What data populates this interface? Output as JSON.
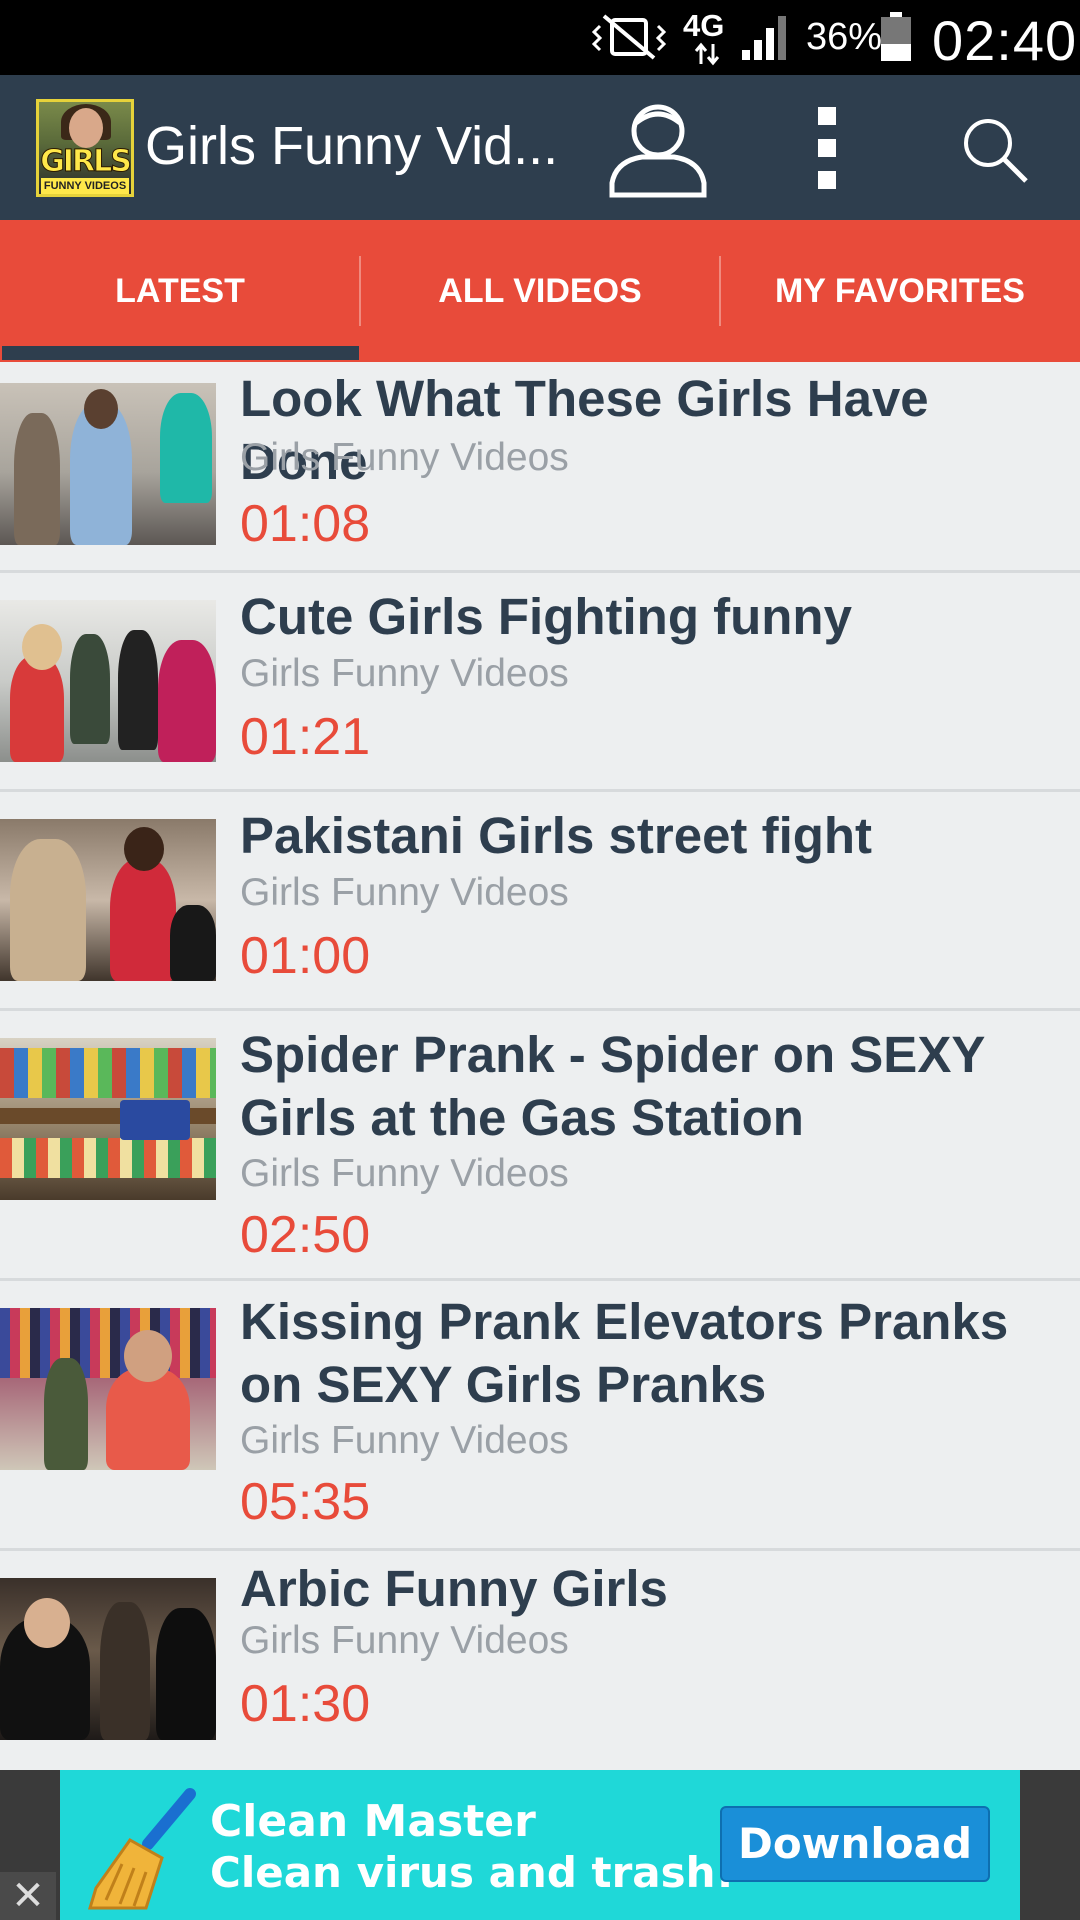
{
  "status_bar": {
    "network": "4G",
    "battery_percent": "36%",
    "time": "02:40",
    "icons": [
      "vibrate-mute-icon",
      "network-4g-icon",
      "signal-icon",
      "battery-icon"
    ]
  },
  "app_bar": {
    "logo_text": "GIRLS",
    "logo_subtext": "FUNNY VIDEOS",
    "title": "Girls Funny Vid...",
    "icons": [
      "profile-icon",
      "more-options-icon",
      "search-icon"
    ]
  },
  "tabs": [
    {
      "label": "LATEST",
      "active": true
    },
    {
      "label": "ALL VIDEOS",
      "active": false
    },
    {
      "label": "MY FAVORITES",
      "active": false
    }
  ],
  "videos": [
    {
      "title": "Look What These Girls Have Done",
      "channel": "Girls Funny Videos",
      "duration": "01:08"
    },
    {
      "title": "Cute Girls Fighting funny",
      "channel": "Girls Funny Videos",
      "duration": "01:21"
    },
    {
      "title": "Pakistani Girls street fight",
      "channel": "Girls Funny Videos",
      "duration": "01:00"
    },
    {
      "title": "Spider Prank - Spider on SEXY Girls at the Gas Station",
      "channel": "Girls Funny Videos",
      "duration": "02:50"
    },
    {
      "title": "Kissing Prank Elevators Pranks on SEXY Girls Pranks",
      "channel": "Girls Funny Videos",
      "duration": "05:35"
    },
    {
      "title": "Arbic Funny Girls",
      "channel": "Girls Funny Videos",
      "duration": "01:30"
    }
  ],
  "ad": {
    "line1": "Clean Master",
    "line2": "Clean virus and trash!",
    "button_label": "Download",
    "close_label": "✕"
  },
  "colors": {
    "status_bar": "#000000",
    "app_bar": "#2e3e4e",
    "tab_bar": "#e84b3a",
    "tab_indicator": "#2e3e4e",
    "list_background": "#edeff0",
    "title_text": "#2e3e4e",
    "channel_text": "#9aa0a6",
    "duration_text": "#e84b3a",
    "ad_background": "#1fd8d8",
    "ad_button": "#1a8fd8"
  }
}
